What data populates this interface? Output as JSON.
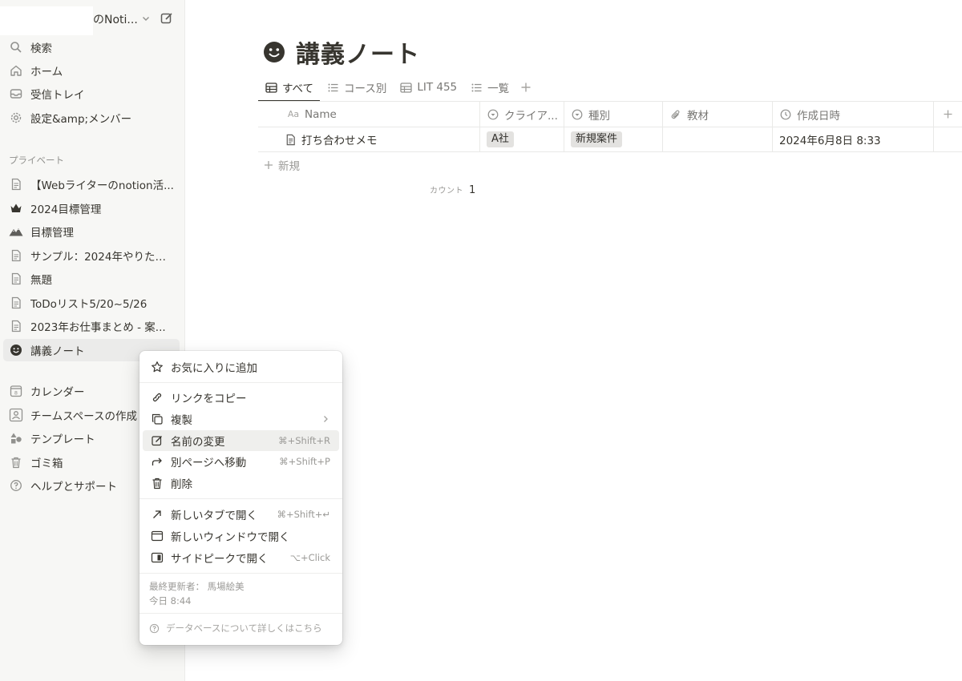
{
  "workspace": {
    "name": "のNoti..."
  },
  "sidebar": {
    "top_items": [
      {
        "label": "検索",
        "icon": "search-icon"
      },
      {
        "label": "ホーム",
        "icon": "home-icon"
      },
      {
        "label": "受信トレイ",
        "icon": "inbox-icon"
      },
      {
        "label": "設定&amp;メンバー",
        "icon": "gear-icon"
      }
    ],
    "section_label": "プライベート",
    "pages": [
      {
        "label": "【Webライターのnotion活...",
        "icon": "page-icon"
      },
      {
        "label": "2024目標管理",
        "icon": "crown-icon"
      },
      {
        "label": "目標管理",
        "icon": "mountain-icon"
      },
      {
        "label": "サンプル：2024年やりたい...",
        "icon": "page-icon"
      },
      {
        "label": "無題",
        "icon": "page-icon"
      },
      {
        "label": "ToDoリスト5/20~5/26",
        "icon": "page-icon"
      },
      {
        "label": "2023年お仕事まとめ - 案...",
        "icon": "page-icon"
      },
      {
        "label": "講義ノート",
        "icon": "smiley-icon"
      }
    ],
    "bottom_items": [
      {
        "label": "カレンダー",
        "icon": "calendar-icon"
      },
      {
        "label": "チームスペースの作成",
        "icon": "teamspace-icon"
      },
      {
        "label": "テンプレート",
        "icon": "shapes-icon"
      },
      {
        "label": "ゴミ箱",
        "icon": "trash-icon"
      },
      {
        "label": "ヘルプとサポート",
        "icon": "help-icon"
      }
    ]
  },
  "page": {
    "title": "講義ノート",
    "icon": "smiley-icon",
    "tabs": [
      {
        "label": "すべて",
        "icon": "table-icon",
        "active": true
      },
      {
        "label": "コース別",
        "icon": "list-icon"
      },
      {
        "label": "LIT 455",
        "icon": "table-icon"
      },
      {
        "label": "一覧",
        "icon": "list-icon"
      }
    ],
    "table": {
      "columns": [
        {
          "label": "Name",
          "icon": "aa-icon"
        },
        {
          "label": "クライア...",
          "icon": "select-icon"
        },
        {
          "label": "種別",
          "icon": "select-icon"
        },
        {
          "label": "教材",
          "icon": "paperclip-icon"
        },
        {
          "label": "作成日時",
          "icon": "clock-icon"
        }
      ],
      "rows": [
        {
          "name": "打ち合わせメモ",
          "client": "A社",
          "type": "新規案件",
          "material": "",
          "created": "2024年6月8日 8:33"
        }
      ],
      "new_label": "新規",
      "count_label": "カウント",
      "count_value": "1"
    }
  },
  "context_menu": {
    "items": [
      {
        "label": "お気に入りに追加",
        "icon": "star-icon"
      },
      {
        "label": "リンクをコピー",
        "icon": "link-icon"
      },
      {
        "label": "複製",
        "icon": "duplicate-icon"
      },
      {
        "label": "名前の変更",
        "icon": "rename-icon",
        "shortcut": "⌘+Shift+R"
      },
      {
        "label": "別ページへ移動",
        "icon": "move-icon",
        "shortcut": "⌘+Shift+P"
      },
      {
        "label": "削除",
        "icon": "trash-icon"
      },
      {
        "label": "新しいタブで開く",
        "icon": "arrow-up-right-icon",
        "shortcut": "⌘+Shift+↵"
      },
      {
        "label": "新しいウィンドウで開く",
        "icon": "window-icon"
      },
      {
        "label": "サイドピークで開く",
        "icon": "side-peek-icon",
        "shortcut": "⌥+Click"
      }
    ],
    "last_edited_label": "最終更新者： 馬場絵美",
    "last_edited_time": "今日 8:44",
    "help_label": "データベースについて詳しくはこちら"
  },
  "colors": {
    "text": "#37352f",
    "muted": "#787774",
    "sidebar_bg": "#f7f7f5",
    "tag_bg": "#e3e2e0"
  }
}
